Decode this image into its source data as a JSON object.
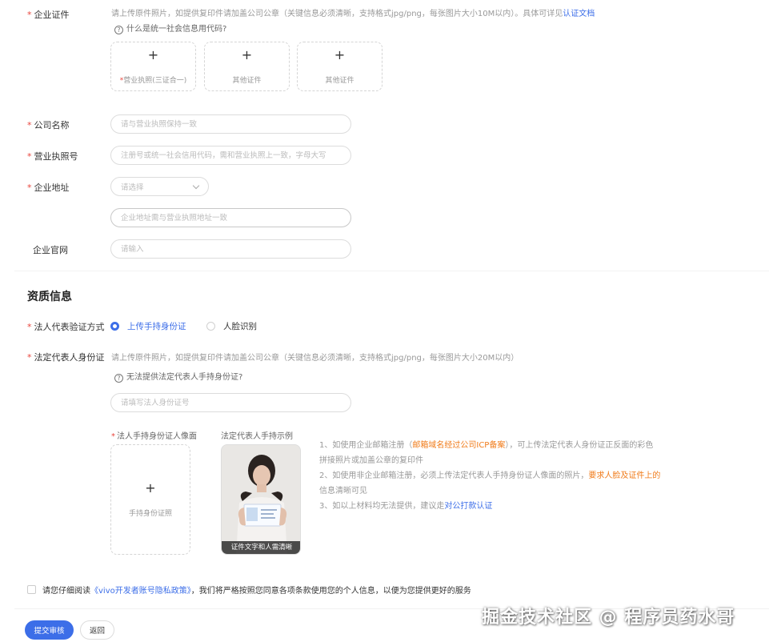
{
  "enterprise_cert": {
    "label": "企业证件",
    "hint": "请上传原件照片，如提供复印件请加盖公司公章（关键信息必须清晰，支持格式jpg/png，每张图片大小10M以内）。具体可详见",
    "hint_link": "认证文档",
    "question": "什么是统一社会信息用代码?",
    "uploads": [
      {
        "caption": "营业执照(三证合一)",
        "required": true
      },
      {
        "caption": "其他证件",
        "required": false
      },
      {
        "caption": "其他证件",
        "required": false
      }
    ]
  },
  "company_name": {
    "label": "公司名称",
    "placeholder": "请与营业执照保持一致"
  },
  "license_no": {
    "label": "营业执照号",
    "placeholder": "注册号或统一社会信用代码，需和营业执照上一致，字母大写"
  },
  "address": {
    "label": "企业地址",
    "select_placeholder": "请选择",
    "detail_placeholder": "企业地址需与营业执照地址一致"
  },
  "website": {
    "label": "企业官网",
    "placeholder": "请输入"
  },
  "qualification": {
    "title": "资质信息",
    "verify_label": "法人代表验证方式",
    "options": [
      "上传手持身份证",
      "人脸识别"
    ],
    "id_label": "法定代表人身份证",
    "id_hint": "请上传原件照片，如提供复印件请加盖公司公章（关键信息必须清晰，支持格式jpg/png，每张图片大小20M以内）",
    "id_question": "无法提供法定代表人手持身份证?",
    "id_placeholder": "请填写法人身份证号",
    "hold_label": "法人手持身份证人像面",
    "upload_caption": "手持身份证照",
    "example_label": "法定代表人手持示例",
    "example_caption": "证件文字和人需清晰",
    "notes": {
      "n1_a": "1、如使用企业邮箱注册（",
      "n1_b": "邮箱域名经过公司ICP备案",
      "n1_c": "），可上传法定代表人身份证正反面的彩色",
      "n1_d": "拼接照片或加盖公章的复印件",
      "n2_a": "2、如使用非企业邮箱注册，必须上传法定代表人手持身份证人像面的照片，",
      "n2_b": "要求人脸及证件上的",
      "n2_c": "信息清晰可见",
      "n3_a": "3、如以上材料均无法提供，建议走",
      "n3_b": "对公打款认证"
    }
  },
  "agreement": {
    "prefix": "请您仔细阅读",
    "link": "《vivo开发者账号隐私政策》",
    "suffix": "，我们将严格按照您同意各项条款使用您的个人信息，以便为您提供更好的服务"
  },
  "buttons": {
    "submit": "提交审核",
    "back": "返回"
  },
  "watermark": "掘金技术社区 @ 程序员药水哥",
  "colors": {
    "accent": "#3c6ee8",
    "required": "#e8453c",
    "warning": "#f07b1a"
  }
}
